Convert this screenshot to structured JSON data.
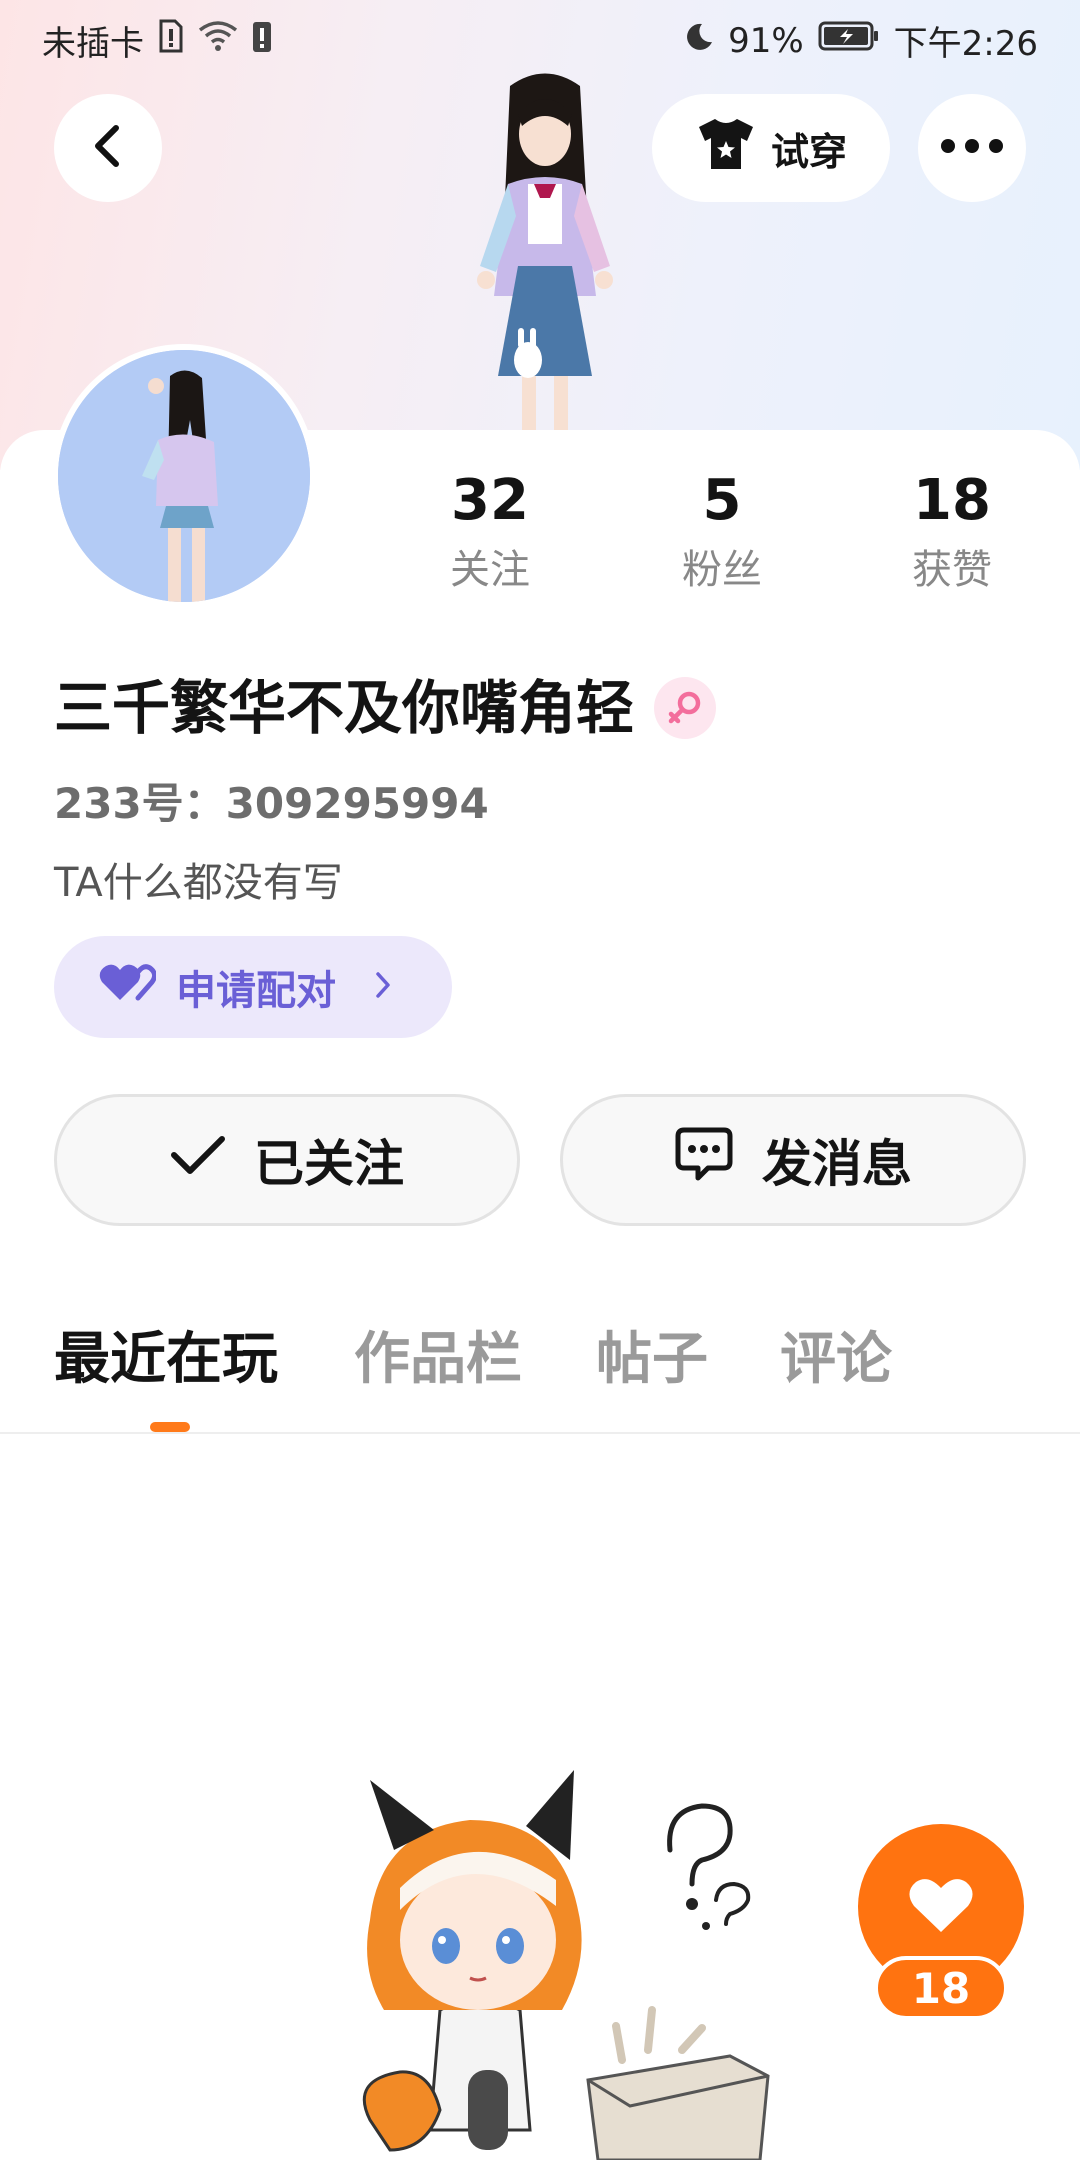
{
  "status_bar": {
    "carrier": "未插卡",
    "battery": "91%",
    "time": "下午2:26"
  },
  "header": {
    "try_on_label": "试穿"
  },
  "profile": {
    "name": "三千繁华不及你嘴角轻",
    "uid_text": "233号：309295994",
    "bio": "TA什么都没有写",
    "pair_label": "申请配对",
    "stats": [
      {
        "value": "32",
        "label": "关注"
      },
      {
        "value": "5",
        "label": "粉丝"
      },
      {
        "value": "18",
        "label": "获赞"
      }
    ]
  },
  "actions": {
    "followed_label": "已关注",
    "message_label": "发消息"
  },
  "tabs": [
    {
      "label": "最近在玩",
      "active": true
    },
    {
      "label": "作品栏",
      "active": false
    },
    {
      "label": "帖子",
      "active": false
    },
    {
      "label": "评论",
      "active": false
    }
  ],
  "like": {
    "count": "18"
  },
  "colors": {
    "accent": "#ff7310",
    "pair_bg": "#ece8fb",
    "pair_text": "#6a5fd6"
  }
}
